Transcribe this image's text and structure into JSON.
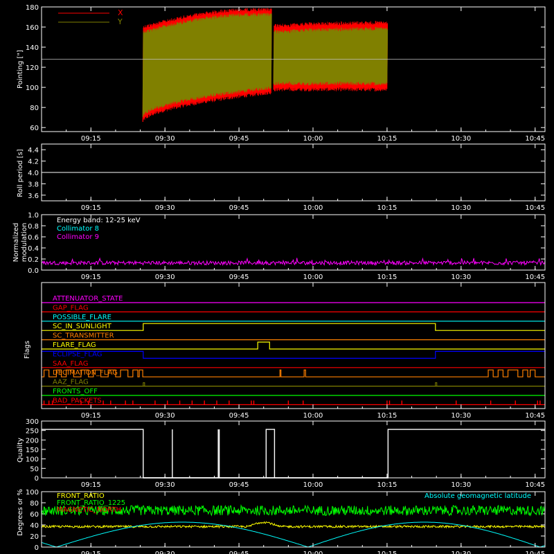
{
  "time_ticks": [
    "09:15",
    "09:30",
    "09:45",
    "10:00",
    "10:15",
    "10:30",
    "10:45"
  ],
  "time_tick_minutes": [
    555,
    570,
    585,
    600,
    615,
    630,
    645
  ],
  "time_range_minutes": [
    545,
    647
  ],
  "chart_data": [
    {
      "type": "line",
      "panel": "pointing",
      "ylabel": "Pointing [\"]",
      "ylim": [
        56,
        180
      ],
      "yticks": [
        60,
        80,
        100,
        120,
        140,
        160,
        180
      ],
      "reference_line": 128,
      "legend": [
        "X",
        "Y"
      ],
      "colors": {
        "X": "#ff0000",
        "Y": "#808000",
        "ref": "#c0c0c0"
      },
      "segments": [
        {
          "start": 565.5,
          "end": 591.5,
          "y_lower": [
            70,
            100
          ],
          "y_upper": [
            155,
            172
          ],
          "x_extra": 5
        },
        {
          "start": 592.0,
          "end": 615.0,
          "y_lower": [
            104,
            104
          ],
          "y_upper": [
            155,
            158
          ],
          "x_extra": 6
        }
      ],
      "roll_period_s": 4.0
    },
    {
      "type": "line",
      "panel": "roll",
      "ylabel": "Roll period [s]",
      "ylim": [
        3.5,
        4.5
      ],
      "yticks": [
        3.6,
        3.8,
        4.0,
        4.2,
        4.4
      ],
      "value": 4.0,
      "color": "#ffffff"
    },
    {
      "type": "line",
      "panel": "modulation",
      "ylabel": "Normalized modulation",
      "ylim": [
        0,
        1.0
      ],
      "yticks": [
        0.0,
        0.2,
        0.4,
        0.6,
        0.8,
        1.0
      ],
      "legend": [
        {
          "label": "Energy band: 12-25 keV",
          "color": "#ffffff"
        },
        {
          "label": "Collimator 8",
          "color": "#00ffff"
        },
        {
          "label": "Collimator 9",
          "color": "#ff00ff"
        }
      ],
      "mean": 0.13
    },
    {
      "type": "line",
      "panel": "flags",
      "ylabel": "Flags",
      "flags": [
        {
          "label": "ATTENUATOR_STATE",
          "color": "#ff00ff"
        },
        {
          "label": "GAP_FLAG",
          "color": "#ff0000"
        },
        {
          "label": "POSSIBLE_FLARE",
          "color": "#00ffff"
        },
        {
          "label": "SC_IN_SUNLIGHT",
          "color": "#ffff00",
          "high": [
            [
              565.6,
              624.8
            ]
          ]
        },
        {
          "label": "SC_TRANSMITTER",
          "color": "#ff8000"
        },
        {
          "label": "FLARE_FLAG",
          "color": "#ffff00",
          "high": [
            [
              588.8,
              591.2
            ]
          ]
        },
        {
          "label": "ECLIPSE_FLAG",
          "color": "#0000ff",
          "high": [
            [
              545,
              565.6
            ],
            [
              624.8,
              647
            ]
          ]
        },
        {
          "label": "SAA_FLAG",
          "color": "#ff0000"
        },
        {
          "label": "DECIMATION_FLAG",
          "color": "#ff8000"
        },
        {
          "label": "AAZ_FLAG",
          "color": "#808000"
        },
        {
          "label": "FRONTS_OFF",
          "color": "#00ff00"
        },
        {
          "label": "BAD_PACKETS",
          "color": "#ff0000"
        }
      ],
      "decimation_pulses": [
        [
          545.5,
          546.5
        ],
        [
          548,
          549
        ],
        [
          550,
          551.5
        ],
        [
          553,
          554.5
        ],
        [
          555.5,
          557
        ],
        [
          558.5,
          560
        ],
        [
          561,
          562.5
        ],
        [
          563.5,
          564.5
        ],
        [
          564.8,
          565.5
        ],
        [
          593.3,
          593.5
        ],
        [
          598.2,
          598.5
        ],
        [
          635.5,
          636.5
        ],
        [
          637.5,
          638.5
        ],
        [
          639.5,
          641.5
        ],
        [
          642.5,
          643.5
        ],
        [
          644,
          645
        ]
      ],
      "aaz_pulses": [
        565.6,
        624.8
      ],
      "bad_packet_times": [
        545.5,
        546.5,
        547.2,
        553,
        554.5,
        557.5,
        559,
        562,
        563.5,
        568,
        570.5,
        573,
        575.5,
        578,
        580.5,
        583,
        587.5,
        588,
        595,
        598,
        615,
        615.5,
        618,
        629,
        636,
        641,
        645.5,
        646
      ]
    },
    {
      "type": "line",
      "panel": "quality",
      "ylabel": "Quality",
      "ylim": [
        0,
        300
      ],
      "yticks": [
        0,
        50,
        100,
        150,
        200,
        250,
        300
      ],
      "high_value": 256,
      "high_intervals": [
        [
          545,
          565.6
        ],
        [
          615.2,
          647
        ]
      ],
      "spikes": [
        571.5,
        580.8,
        581.0
      ],
      "blocks": [
        [
          590.5,
          592.2
        ]
      ]
    },
    {
      "type": "line",
      "panel": "geomagnetic",
      "ylabel": "Degrees or %",
      "ylim": [
        0,
        100
      ],
      "yticks": [
        0,
        20,
        40,
        60,
        80,
        100
      ],
      "legend": [
        {
          "label": "FRONT_RATIO",
          "color": "#ffff00"
        },
        {
          "label": "FRONT_RATIO_1225",
          "color": "#00ff00"
        },
        {
          "label": "MAGNETIC_NORTH",
          "color": "#ff0000"
        }
      ],
      "right_legend": {
        "label": "Absolute geomagnetic latitude",
        "color": "#00ffff"
      },
      "latitude_peak": 45,
      "latitude_zero_minutes": [
        548,
        599,
        646
      ],
      "front_ratio_mean": 37,
      "front_ratio_1225_mean": 66
    }
  ]
}
